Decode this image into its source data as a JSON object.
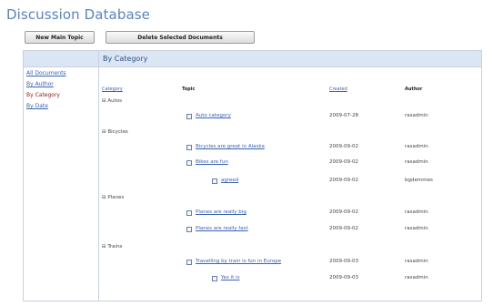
{
  "app": {
    "title": "Discussion Database"
  },
  "toolbar": {
    "new_main_topic": "New Main Topic",
    "delete_selected": "Delete Selected Documents"
  },
  "sidebar": {
    "items": [
      {
        "label": "All Documents",
        "active": false
      },
      {
        "label": "By Author",
        "active": false
      },
      {
        "label": "By Category",
        "active": true
      },
      {
        "label": "By Date",
        "active": false
      }
    ]
  },
  "view": {
    "title": "By Category",
    "columns": {
      "category": "Category",
      "topic": "Topic",
      "created": "Created",
      "author": "Author"
    },
    "categories": [
      {
        "label": "Autos"
      },
      {
        "label": "Bicycles"
      },
      {
        "label": "Planes"
      },
      {
        "label": "Trains"
      }
    ],
    "rows": [
      {
        "topic": "Auto category",
        "created": "2009-07-28",
        "author": "rasadmin"
      },
      {
        "topic": "Bicycles are great in Alaska",
        "created": "2009-09-02",
        "author": "rasadmin"
      },
      {
        "topic": "Bikes are fun",
        "created": "2009-09-02",
        "author": "rasadmin"
      },
      {
        "topic": "agreed",
        "created": "2009-09-02",
        "author": "bgdemmes"
      },
      {
        "topic": "Planes are really big",
        "created": "2009-09-02",
        "author": "rasadmin"
      },
      {
        "topic": "Planes are really fast",
        "created": "2009-09-02",
        "author": "rasadmin"
      },
      {
        "topic": "Travelling by train is fun in Europe",
        "created": "2009-09-03",
        "author": "rasadmin"
      },
      {
        "topic": "Yes it is",
        "created": "2009-09-03",
        "author": "rasadmin"
      }
    ]
  }
}
